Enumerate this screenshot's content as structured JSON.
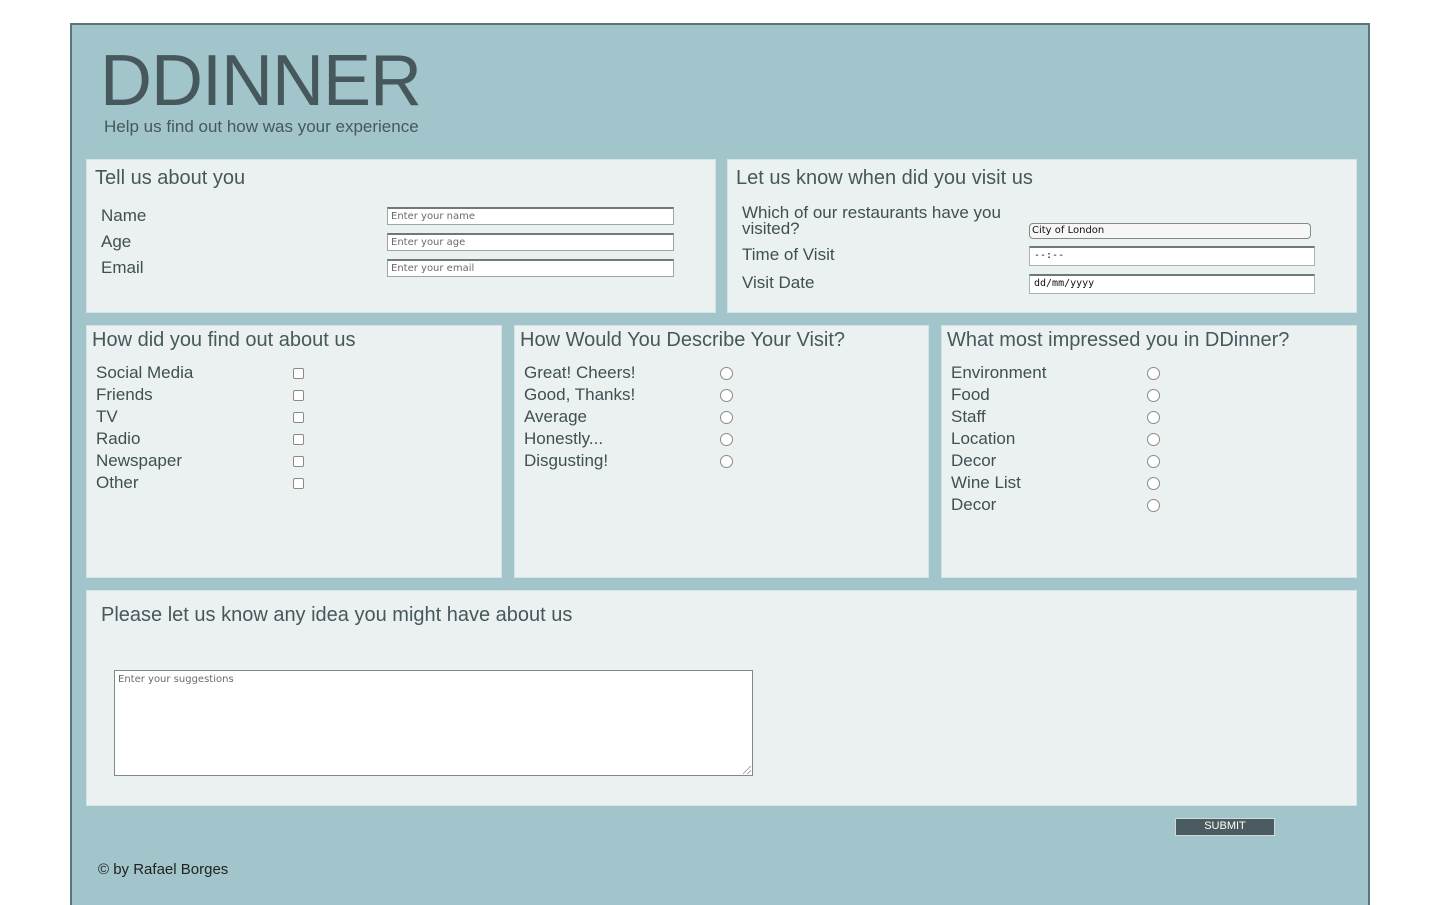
{
  "header": {
    "title": "DDINNER",
    "subtitle": "Help us find out how was your experience"
  },
  "about_you": {
    "heading": "Tell us about you",
    "fields": [
      {
        "label": "Name",
        "placeholder": "Enter your name"
      },
      {
        "label": "Age",
        "placeholder": "Enter your age"
      },
      {
        "label": "Email",
        "placeholder": "Enter your email"
      }
    ]
  },
  "visit": {
    "heading": "Let us know when did you visit us",
    "restaurant_label": "Which of our restaurants have you visited?",
    "restaurant_value": "City of London",
    "time_label": "Time of Visit",
    "time_value": "--:--",
    "date_label": "Visit Date",
    "date_value": "dd/mm/yyyy"
  },
  "found_us": {
    "heading": "How did you find out about us",
    "options": [
      "Social Media",
      "Friends",
      "TV",
      "Radio",
      "Newspaper",
      "Other"
    ]
  },
  "describe": {
    "heading": "How Would You Describe Your Visit?",
    "options": [
      "Great! Cheers!",
      "Good, Thanks!",
      "Average",
      "Honestly...",
      "Disgusting!"
    ]
  },
  "impressed": {
    "heading": "What most impressed you in DDinner?",
    "options": [
      "Environment",
      "Food",
      "Staff",
      "Location",
      "Decor",
      "Wine List",
      "Decor"
    ]
  },
  "suggestions": {
    "heading": "Please let us know any idea you might have about us",
    "placeholder": "Enter your suggestions"
  },
  "submit_label": "SUBMIT",
  "footer": "© by Rafael Borges",
  "colors": {
    "background": "#a1c5cb",
    "panel": "#ebf1f1",
    "text": "#46585c",
    "button": "#4a5c60"
  }
}
